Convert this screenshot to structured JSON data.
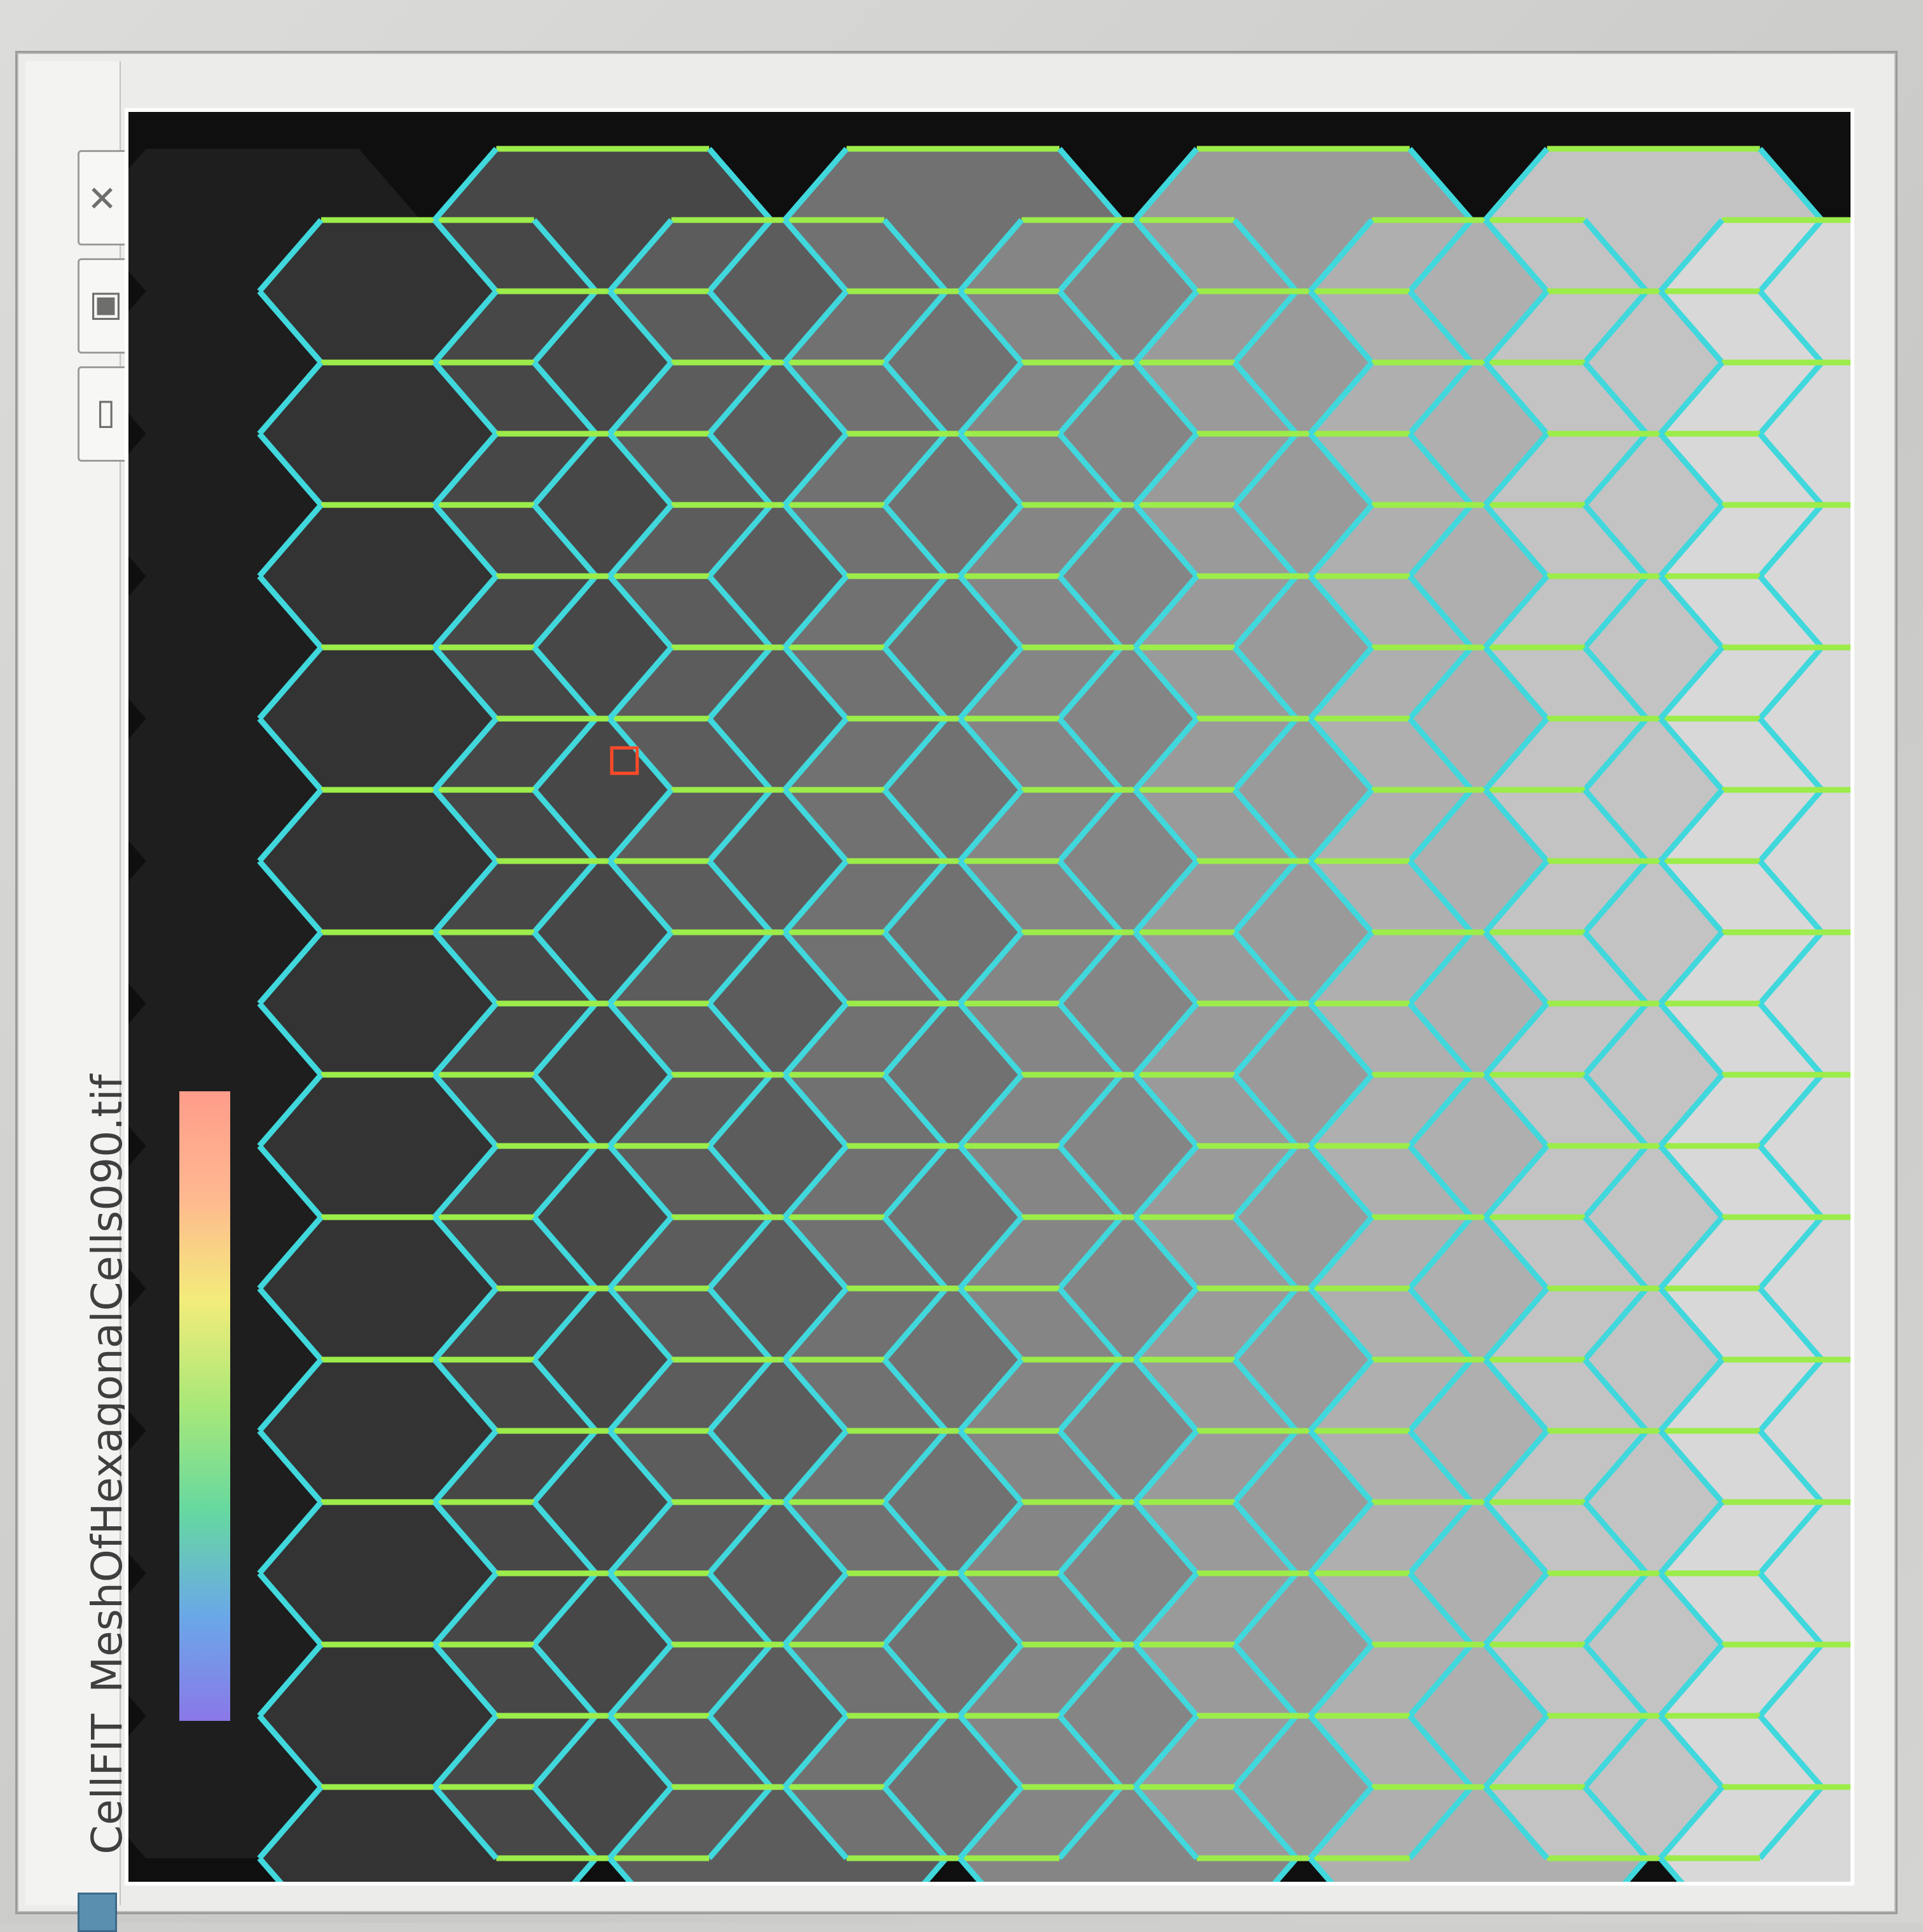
{
  "window": {
    "title": "CellFIT_MeshOfHexagonalCells090.tif",
    "controls": {
      "close_glyph": "✕",
      "maximize_glyph": "▣",
      "minimize_glyph": "▭"
    }
  },
  "mesh": {
    "cell_count_columns": 10,
    "cell_count_rows": 12,
    "edge_colors": {
      "vertical_edges": "#40d8dc",
      "horizontal_edges": "#9cec4a"
    },
    "cell_shade_dark": "#1e1e1e",
    "cell_shade_light": "#d8d8d8",
    "selection_marker_color": "#ff4a2a"
  },
  "colorbar": {
    "stops": [
      "#8a78e8",
      "#6aa8e8",
      "#66d8a0",
      "#a8e878",
      "#f2ec7a",
      "#ffb890",
      "#ff9c8a"
    ]
  }
}
